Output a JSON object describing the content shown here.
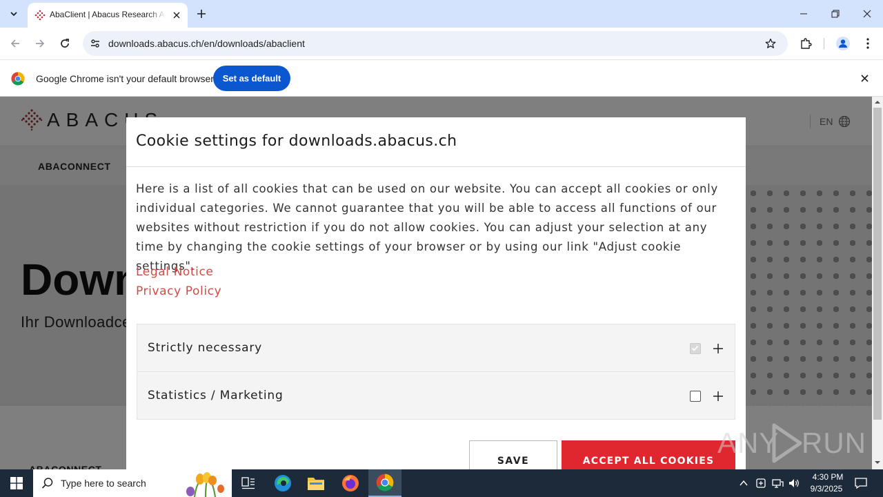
{
  "browser": {
    "tab_title": "AbaClient | Abacus Research AG",
    "url": "downloads.abacus.ch/en/downloads/abaclient",
    "infobar_text": "Google Chrome isn't your default browser",
    "set_default_label": "Set as default"
  },
  "site": {
    "logo_text": "ABACUS",
    "language": "EN",
    "nav_item": "ABACONNECT",
    "hero_title": "Downloads",
    "hero_subtitle": "Ihr Downloadcenter",
    "section_label": "ABACONNECT"
  },
  "cookie_modal": {
    "title": "Cookie settings for downloads.abacus.ch",
    "body": "Here is a list of all cookies that can be used on our website. You can accept all cookies or only individual categories. We cannot guarantee that you will be able to access all functions of our websites without restriction if you do not allow cookies. You can adjust your selection at any time by changing the cookie settings of your browser or by using our link \"Adjust cookie settings\".",
    "legal_notice": "Legal Notice",
    "privacy_policy": "Privacy Policy",
    "categories": [
      {
        "label": "Strictly necessary",
        "checked": true,
        "disabled": true
      },
      {
        "label": "Statistics / Marketing",
        "checked": false,
        "disabled": false
      }
    ],
    "save_label": "SAVE",
    "accept_label": "ACCEPT ALL COOKIES",
    "accent_color": "#e0262e",
    "link_color": "#d44a43"
  },
  "watermark": {
    "left": "ANY",
    "right": "RUN"
  },
  "taskbar": {
    "search_placeholder": "Type here to search",
    "time": "4:30 PM",
    "date": "9/3/2025"
  }
}
